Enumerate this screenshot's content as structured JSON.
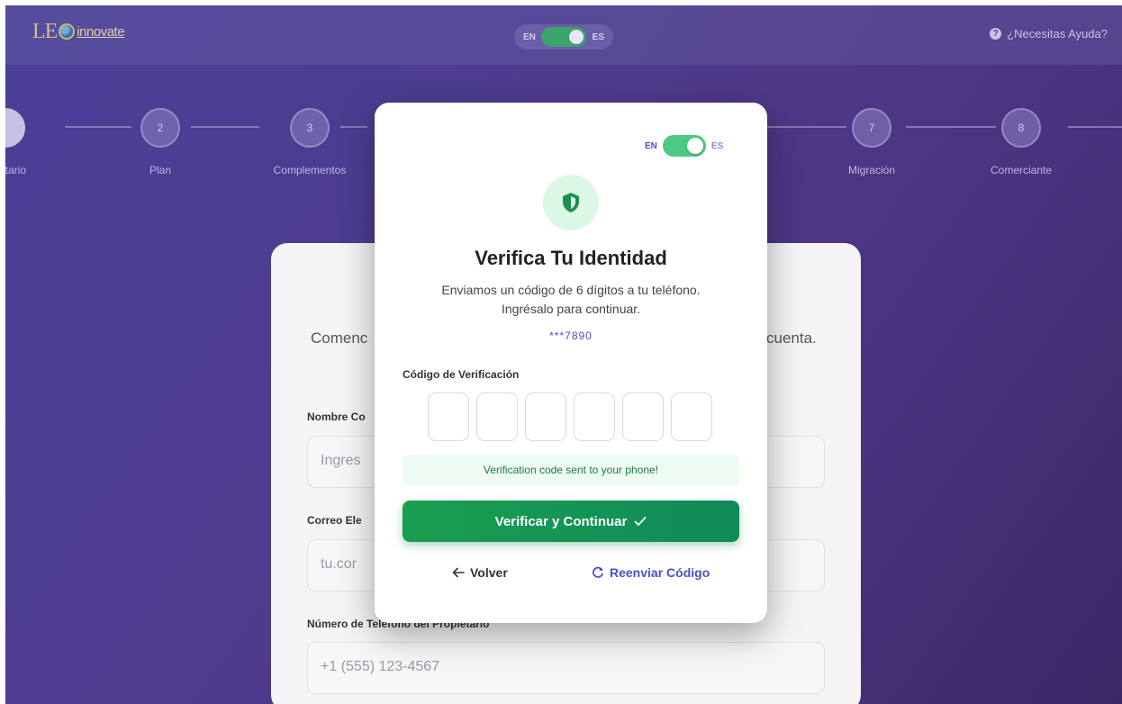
{
  "header": {
    "logo_le": "LE",
    "logo_name": "innovate",
    "lang_left": "EN",
    "lang_right": "ES",
    "help": "¿Necesitas Ayuda?"
  },
  "steps": [
    {
      "number": "",
      "label": "opietario"
    },
    {
      "number": "2",
      "label": "Plan"
    },
    {
      "number": "3",
      "label": "Complementos"
    },
    {
      "number": "7",
      "label": "Migración"
    },
    {
      "number": "8",
      "label": "Comerciante"
    }
  ],
  "form": {
    "intro_left": "Comenc",
    "intro_right": "cuenta.",
    "name_label": "Nombre Co",
    "name_placeholder": "Ingres",
    "email_label": "Correo Ele",
    "email_placeholder": "tu.cor",
    "phone_label": "Número de Teléfono del Propietario",
    "phone_placeholder": "+1 (555) 123-4567"
  },
  "modal": {
    "lang_left": "EN",
    "lang_right": "ES",
    "title": "Verifica Tu Identidad",
    "subtitle_line1": "Enviamos un código de 6 dígitos a tu teléfono.",
    "subtitle_line2": "Ingrésalo para continuar.",
    "masked_phone": "***7890",
    "code_label": "Código de Verificación",
    "message": "Verification code sent to your phone!",
    "verify_button": "Verificar y Continuar",
    "back_button": "Volver",
    "resend_button": "Reenviar Código"
  },
  "colors": {
    "accent": "#4b50c9",
    "success": "#1a9e50",
    "toggle_on": "#4cc985"
  },
  "icons": {
    "shield": "shield-icon",
    "check": "check-icon",
    "back": "arrow-left-icon",
    "resend": "refresh-icon",
    "help": "question-icon"
  }
}
